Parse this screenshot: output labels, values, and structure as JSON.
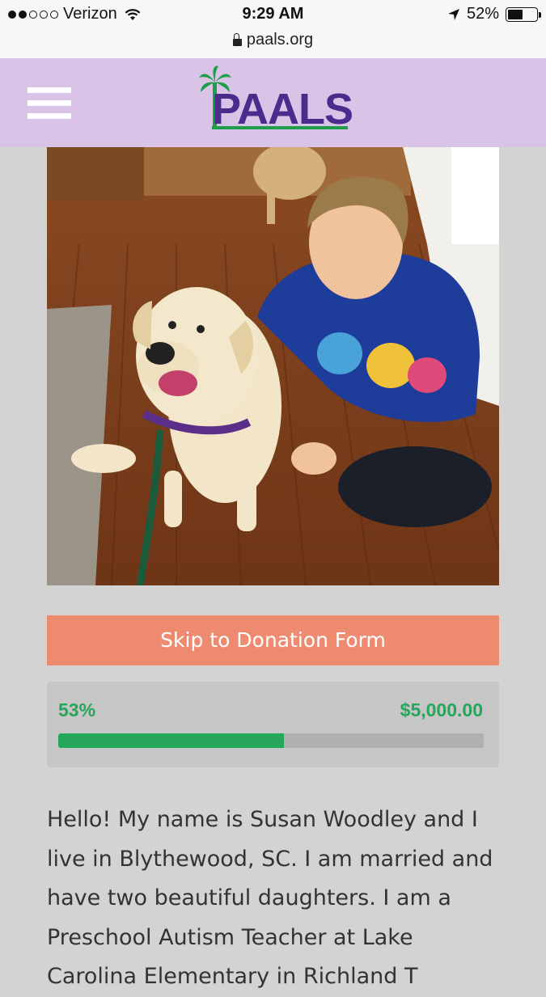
{
  "status_bar": {
    "carrier": "Verizon",
    "time": "9:29 AM",
    "battery": "52%",
    "battery_level": 0.52,
    "url": "paals.org"
  },
  "header": {
    "logo_text": "PAALS"
  },
  "colors": {
    "header_bg": "#d9c4e8",
    "brand_purple": "#4a2c8c",
    "brand_green": "#26a65b",
    "button_orange": "#ee8a6f",
    "page_bg": "#d3d3d3"
  },
  "donation": {
    "skip_label": "Skip to Donation Form",
    "percent_label": "53%",
    "percent_value": 0.53,
    "goal": "$5,000.00"
  },
  "bio": {
    "text": "Hello! My name is Susan Woodley and I live in Blythewood, SC. I am married and have two beautiful daughters. I am a Preschool Autism Teacher at Lake Carolina Elementary in Richland T"
  }
}
